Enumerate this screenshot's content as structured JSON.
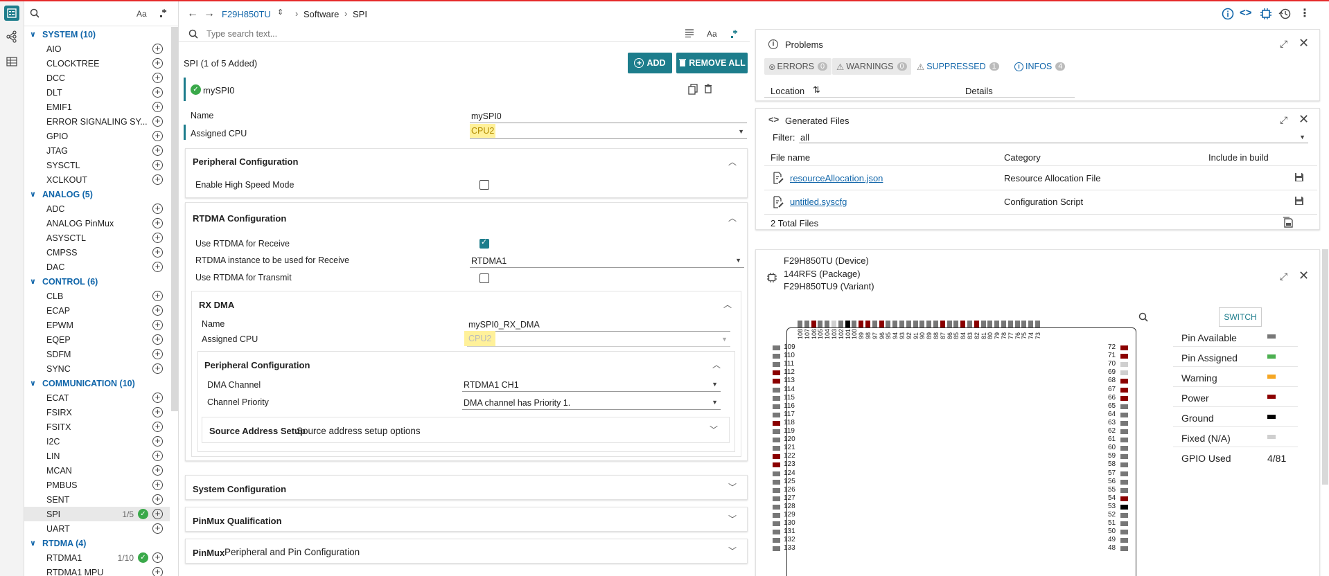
{
  "sidebar": {
    "search_placeholder": "",
    "font_toggle": "Aa",
    "categories": [
      {
        "name": "SYSTEM (10)",
        "items": [
          "AIO",
          "CLOCKTREE",
          "DCC",
          "DLT",
          "EMIF1",
          "ERROR SIGNALING SY...",
          "GPIO",
          "JTAG",
          "SYSCTL",
          "XCLKOUT"
        ]
      },
      {
        "name": "ANALOG (5)",
        "items": [
          "ADC",
          "ANALOG PinMux",
          "ASYSCTL",
          "CMPSS",
          "DAC"
        ]
      },
      {
        "name": "CONTROL (6)",
        "items": [
          "CLB",
          "ECAP",
          "EPWM",
          "EQEP",
          "SDFM",
          "SYNC"
        ]
      },
      {
        "name": "COMMUNICATION (10)",
        "items": [
          "ECAT",
          "FSIRX",
          "FSITX",
          "I2C",
          "LIN",
          "MCAN",
          "PMBUS",
          "SENT",
          "SPI",
          "UART"
        ]
      },
      {
        "name": "RTDMA (4)",
        "items": [
          "RTDMA1",
          "RTDMA1 MPU"
        ]
      }
    ],
    "spi_count": "1/5",
    "rtdma1_count": "1/10"
  },
  "topbar": {
    "device": "F29H850TU",
    "crumb1": "Software",
    "crumb2": "SPI"
  },
  "mid": {
    "search_placeholder": "Type search text...",
    "font_toggle": "Aa",
    "header_title": "SPI (1 of 5 Added)",
    "add_label": "ADD",
    "remove_all_label": "REMOVE ALL",
    "instance_name": "mySPI0",
    "name_label": "Name",
    "name_value": "mySPI0",
    "cpu_label": "Assigned CPU",
    "cpu_value": "CPU2",
    "periph_config": "Peripheral Configuration",
    "high_speed_label": "Enable High Speed Mode",
    "rtdma_config": "RTDMA Configuration",
    "use_rx_label": "Use RTDMA for Receive",
    "rx_instance_label": "RTDMA instance to be used for Receive",
    "rx_instance_value": "RTDMA1",
    "use_tx_label": "Use RTDMA for Transmit",
    "rxdma_title": "RX DMA",
    "rxdma_name_label": "Name",
    "rxdma_name_value": "mySPI0_RX_DMA",
    "rxdma_cpu_label": "Assigned CPU",
    "rxdma_cpu_value": "CPU2",
    "rxdma_periph_config": "Peripheral Configuration",
    "dma_channel_label": "DMA Channel",
    "dma_channel_value": "RTDMA1 CH1",
    "channel_priority_label": "Channel Priority",
    "channel_priority_value": "DMA channel has Priority 1.",
    "source_addr_title": "Source Address Setup",
    "source_addr_desc": "Source address setup options",
    "system_config": "System Configuration",
    "pinmux_qual": "PinMux Qualification",
    "pinmux_title": "PinMux",
    "pinmux_desc": "Peripheral and Pin Configuration"
  },
  "problems": {
    "title": "Problems",
    "errors": "ERRORS",
    "errors_count": "0",
    "warnings": "WARNINGS",
    "warnings_count": "0",
    "suppressed": "SUPPRESSED",
    "suppressed_count": "1",
    "infos": "INFOS",
    "infos_count": "4",
    "col_location": "Location",
    "col_details": "Details"
  },
  "generated": {
    "title": "Generated Files",
    "filter_label": "Filter:",
    "filter_value": "all",
    "col_file": "File name",
    "col_category": "Category",
    "col_include": "Include in build",
    "files": [
      {
        "name": "resourceAllocation.json",
        "category": "Resource Allocation File"
      },
      {
        "name": "untitled.syscfg",
        "category": "Configuration Script"
      }
    ],
    "total": "2 Total Files"
  },
  "device": {
    "line1": "F29H850TU (Device)",
    "line2": "144RFS (Package)",
    "line3": "F29H850TU9 (Variant)",
    "switch_label": "SWITCH",
    "top_pins": [
      "108",
      "107",
      "106",
      "105",
      "104",
      "103",
      "102",
      "101",
      "100",
      "99",
      "98",
      "97",
      "96",
      "95",
      "94",
      "93",
      "92",
      "91",
      "90",
      "89",
      "88",
      "87",
      "86",
      "85",
      "84",
      "83",
      "82",
      "81",
      "80",
      "79",
      "78",
      "77",
      "76",
      "75",
      "74",
      "73"
    ],
    "left_pins": [
      "109",
      "110",
      "111",
      "112",
      "113",
      "114",
      "115",
      "116",
      "117",
      "118",
      "119",
      "120",
      "121",
      "122",
      "123",
      "124",
      "125",
      "126",
      "127",
      "128",
      "129",
      "130",
      "131",
      "132",
      "133"
    ],
    "right_pins": [
      "72",
      "71",
      "70",
      "69",
      "68",
      "67",
      "66",
      "65",
      "64",
      "63",
      "62",
      "61",
      "60",
      "59",
      "58",
      "57",
      "56",
      "55",
      "54",
      "53",
      "52",
      "51",
      "50",
      "49",
      "48"
    ],
    "legend": [
      {
        "label": "Pin Available",
        "color": "#777777"
      },
      {
        "label": "Pin Assigned",
        "color": "#4caf50"
      },
      {
        "label": "Warning",
        "color": "#f5a623"
      },
      {
        "label": "Power",
        "color": "#8b0000"
      },
      {
        "label": "Ground",
        "color": "#000000"
      },
      {
        "label": "Fixed (N/A)",
        "color": "#cfcfcf"
      }
    ],
    "gpio_label": "GPIO Used",
    "gpio_value": "4/81"
  },
  "colors": {
    "accent": "#1d7d8c",
    "highlight": "#fff19a",
    "top_border": "#e52b2b"
  }
}
